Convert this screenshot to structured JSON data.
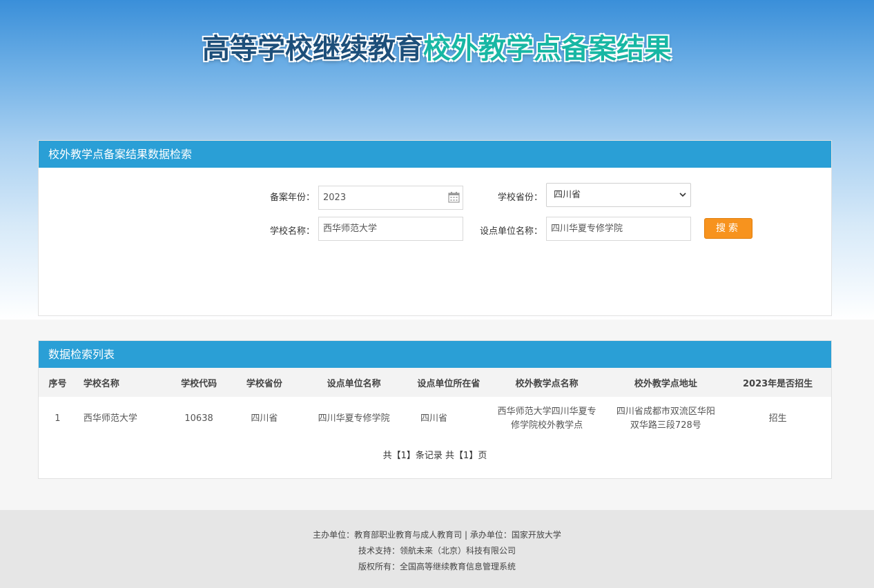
{
  "banner": {
    "title_part1": "高等学校继续教育",
    "title_part2": "校外教学点备案结果"
  },
  "search_panel": {
    "title": "校外教学点备案结果数据检索",
    "year_label": "备案年份：",
    "year_value": "2023",
    "province_label": "学校省份：",
    "province_value": "四川省",
    "school_label": "学校名称：",
    "school_value": "西华师范大学",
    "unit_label": "设点单位名称：",
    "unit_value": "四川华夏专修学院",
    "search_button": "搜索"
  },
  "list_panel": {
    "title": "数据检索列表",
    "columns": [
      "序号",
      "学校名称",
      "学校代码",
      "学校省份",
      "设点单位名称",
      "设点单位所在省",
      "校外教学点名称",
      "校外教学点地址",
      "2023年是否招生"
    ],
    "rows": [
      {
        "index": "1",
        "school": "西华师范大学",
        "code": "10638",
        "province": "四川省",
        "unit": "四川华夏专修学院",
        "unit_province": "四川省",
        "site_name": "西华师范大学四川华夏专修学院校外教学点",
        "site_address": "四川省成都市双流区华阳双华路三段728号",
        "enrolling": "招生"
      }
    ],
    "pager": "共【1】条记录 共【1】页"
  },
  "footer": {
    "line1": "主办单位：教育部职业教育与成人教育司 | 承办单位：国家开放大学",
    "line2": "技术支持：领航未来（北京）科技有限公司",
    "line3": "版权所有：全国高等继续教育信息管理系统"
  },
  "colors": {
    "header_bar": "#2a9fd6",
    "search_button": "#f7931e",
    "title_dark": "#1d4f7a",
    "title_teal": "#18b7a4"
  }
}
